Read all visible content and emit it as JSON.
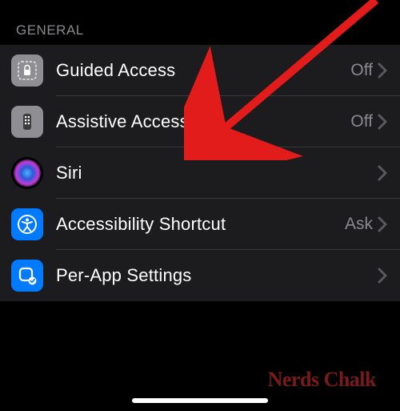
{
  "section": {
    "header": "GENERAL"
  },
  "rows": [
    {
      "label": "Guided Access",
      "value": "Off"
    },
    {
      "label": "Assistive Access",
      "value": "Off"
    },
    {
      "label": "Siri",
      "value": ""
    },
    {
      "label": "Accessibility Shortcut",
      "value": "Ask"
    },
    {
      "label": "Per-App Settings",
      "value": ""
    }
  ],
  "watermark": "Nerds Chalk",
  "colors": {
    "accentBlue": "#007aff",
    "neutralIcon": "#8e8e93",
    "listBg": "#1c1c1e",
    "separator": "#3a3a3c",
    "secondaryText": "#8a8a8e",
    "annotationRed": "#e21b1b"
  }
}
